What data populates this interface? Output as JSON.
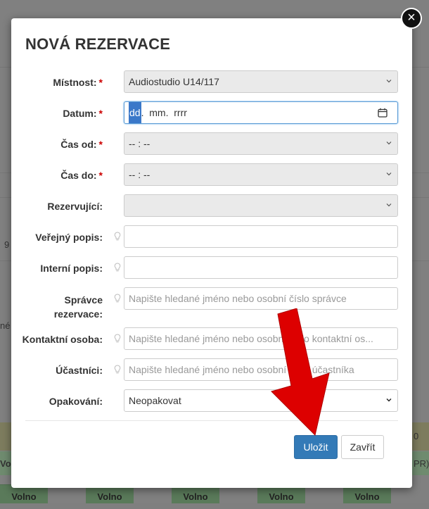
{
  "background": {
    "fragments": [
      "9",
      "né",
      "0",
      "Volno",
      "PR)"
    ],
    "cells": [
      "Volno",
      "Volno",
      "Volno",
      "Volno",
      "Volno"
    ]
  },
  "modal": {
    "title": "NOVÁ REZERVACE",
    "close_glyph": "×",
    "required_mark": "*",
    "fields": {
      "room": {
        "label": "Místnost:",
        "value": "Audiostudio U14/117"
      },
      "date": {
        "label": "Datum:",
        "day": "dd",
        "month": "mm",
        "year": "rrrr",
        "sep": "."
      },
      "time_from": {
        "label": "Čas od:",
        "value": "-- : --"
      },
      "time_to": {
        "label": "Čas do:",
        "value": "-- : --"
      },
      "reserver": {
        "label": "Rezervující:",
        "value": ""
      },
      "public_desc": {
        "label": "Veřejný popis:",
        "value": ""
      },
      "internal_desc": {
        "label": "Interní popis:",
        "value": ""
      },
      "manager": {
        "label_line1": "Správce",
        "label_line2": "rezervace:",
        "placeholder": "Napište hledané jméno nebo osobní číslo správce"
      },
      "contact": {
        "label": "Kontaktní osoba:",
        "placeholder": "Napište hledané jméno nebo osobní číslo kontaktní os..."
      },
      "participants": {
        "label": "Účastníci:",
        "placeholder": "Napište hledané jméno nebo osobní číslo účastníka"
      },
      "repeat": {
        "label": "Opakování:",
        "value": "Neopakovat"
      }
    },
    "buttons": {
      "save": "Uložit",
      "close": "Zavřít"
    }
  },
  "colors": {
    "primary": "#337ab7",
    "required": "#cc0000",
    "arrow": "#dd0000"
  }
}
